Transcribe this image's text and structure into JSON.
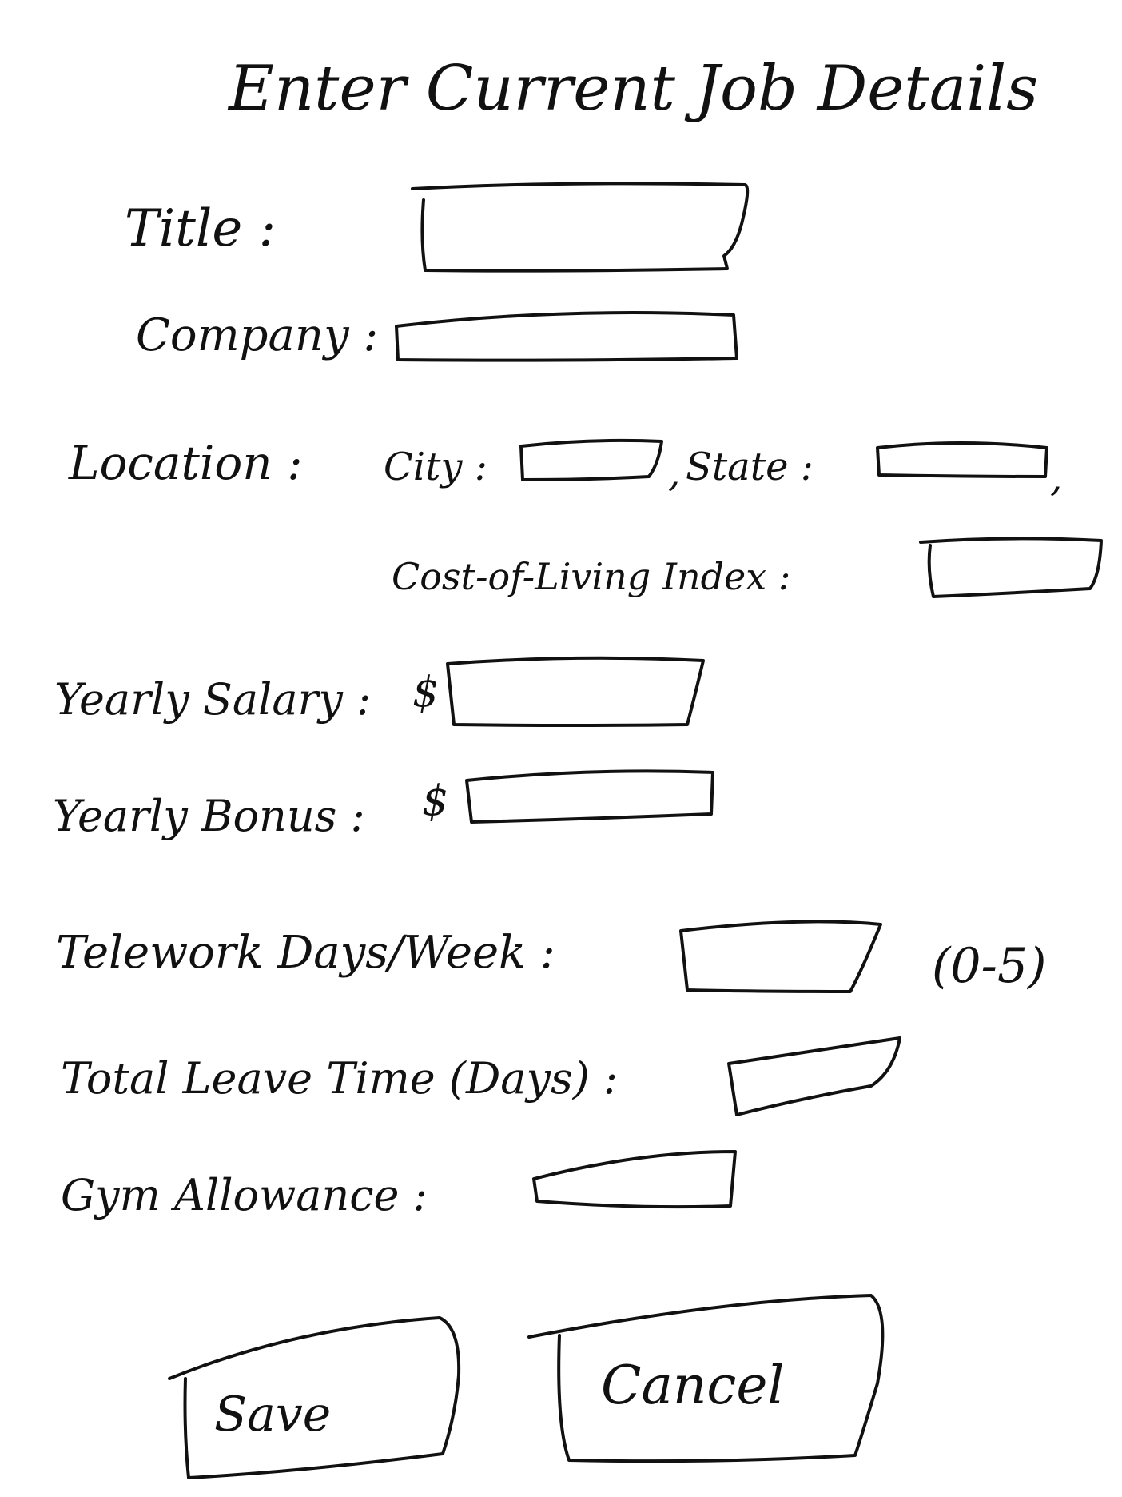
{
  "form": {
    "title": "Enter Current Job Details"
  },
  "fields": {
    "title": {
      "label": "Title :",
      "value": ""
    },
    "company": {
      "label": "Company :",
      "value": ""
    },
    "location": {
      "label": "Location :",
      "city_label": "City :",
      "city_value": "",
      "separator": ",",
      "state_label": "State :",
      "state_value": "",
      "trailing_comma": ",",
      "col_label": "Cost-of-Living Index :",
      "col_value": ""
    },
    "yearly_salary": {
      "label": "Yearly Salary :",
      "currency": "$",
      "value": ""
    },
    "yearly_bonus": {
      "label": "Yearly Bonus :",
      "currency": "$",
      "value": ""
    },
    "telework": {
      "label": "Telework Days/Week :",
      "value": "",
      "hint": "(0-5)"
    },
    "leave": {
      "label": "Total Leave Time (Days) :",
      "value": ""
    },
    "gym": {
      "label": "Gym Allowance :",
      "value": ""
    }
  },
  "buttons": {
    "save_label": "Save",
    "cancel_label": "Cancel"
  },
  "colors": {
    "ink": "#111111",
    "paper": "#ffffff"
  }
}
